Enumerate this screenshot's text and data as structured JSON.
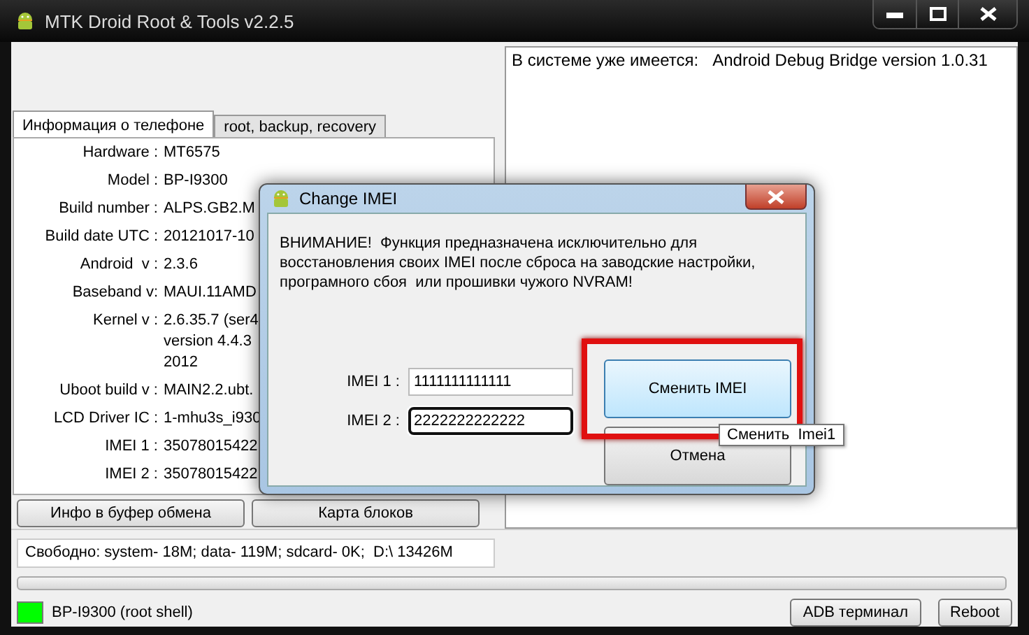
{
  "window": {
    "title": "MTK Droid Root & Tools v2.2.5"
  },
  "tabs": [
    {
      "label": "Информация о телефоне",
      "selected": true
    },
    {
      "label": "root, backup, recovery",
      "selected": false
    }
  ],
  "info_rows": [
    {
      "label": "Hardware :",
      "value_lines": [
        "MT6575"
      ]
    },
    {
      "label": "Model :",
      "value_lines": [
        "BP-I9300"
      ]
    },
    {
      "label": "Build number :",
      "value_lines": [
        "ALPS.GB2.M"
      ]
    },
    {
      "label": "Build date UTC :",
      "value_lines": [
        "20121017-10"
      ]
    },
    {
      "label": "Android  v :",
      "value_lines": [
        "2.3.6"
      ]
    },
    {
      "label": "Baseband v:",
      "value_lines": [
        "MAUI.11AMD"
      ]
    },
    {
      "label": "Kernel v :",
      "value_lines": [
        "2.6.35.7 (ser4",
        "version 4.4.3",
        "2012"
      ]
    },
    {
      "label": "Uboot build v :",
      "value_lines": [
        "MAIN2.2.ubt."
      ]
    },
    {
      "label": "LCD Driver IC :",
      "value_lines": [
        "1-mhu3s_i930"
      ]
    },
    {
      "label": "IMEI 1 :",
      "value_lines": [
        "35078015422"
      ]
    },
    {
      "label": "IMEI 2 :",
      "value_lines": [
        "35078015422"
      ]
    }
  ],
  "buttons": [
    "Инфо в буфер обмена",
    "Карта блоков"
  ],
  "free_space": "Свободно: system- 18M; data- 119M; sdcard- 0K;  D:\\ 13426M",
  "progress": {
    "level": 0
  },
  "status": {
    "device": "BP-I9300 (root shell)",
    "connected": true
  },
  "footer_buttons": [
    "ADB терминал",
    "Reboot"
  ],
  "log": [
    "В системе уже имеется:   Android Debug Bridge version 1.0.31"
  ],
  "dialog": {
    "title": "Change IMEI",
    "warning": "ВНИМАНИЕ!  Функция предназначена исключительно для\nвосстановления своих IMEI после сброса на заводские настройки,\nпрограмного сбоя  или прошивки чужого NVRAM!",
    "fields": [
      {
        "label": "IMEI 1 :",
        "value": "1111111111111",
        "focused": false
      },
      {
        "label": "IMEI 2 :",
        "value": "2222222222222",
        "focused": true
      }
    ],
    "buttons": [
      {
        "label": "Сменить IMEI",
        "hovered": true
      },
      {
        "label": "Отмена",
        "hovered": false
      }
    ],
    "tooltip": "Сменить  Imei1"
  }
}
